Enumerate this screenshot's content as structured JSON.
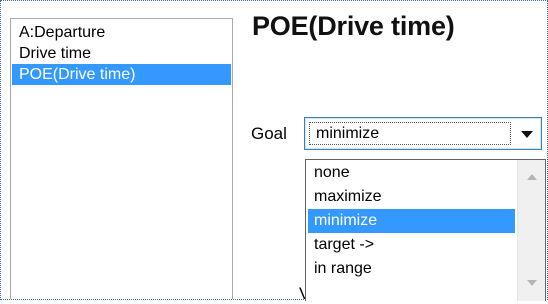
{
  "node_list": {
    "items": [
      {
        "label": "A:Departure"
      },
      {
        "label": "Drive time"
      },
      {
        "label": "POE(Drive time)"
      }
    ],
    "selected_index": 2
  },
  "panel": {
    "title": "POE(Drive time)"
  },
  "goal": {
    "label": "Goal",
    "selected_value": "minimize",
    "options": [
      "none",
      "maximize",
      "minimize",
      "target ->",
      "in range"
    ],
    "selected_option_index": 2
  },
  "partially_hidden_label": "Variance",
  "colors": {
    "selection": "#3399ff",
    "focus_border": "#3c7fb1",
    "frame_border": "#3a66b8"
  },
  "icons": {
    "dropdown_arrow": "chevron-down-icon",
    "scroll_up": "scroll-up-arrow-icon",
    "scroll_down": "scroll-down-arrow-icon"
  }
}
